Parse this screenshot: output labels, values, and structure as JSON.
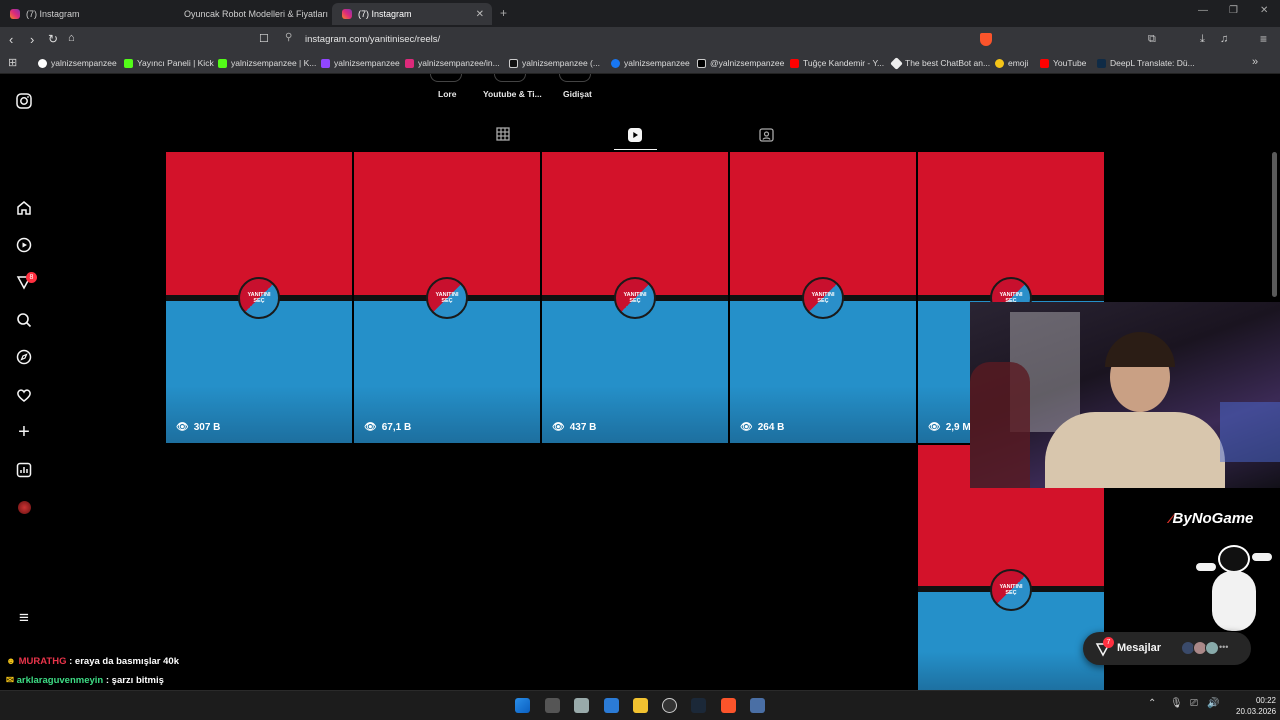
{
  "browser": {
    "tabs": [
      {
        "label": "(7) Instagram",
        "active": false
      },
      {
        "label": "Oyuncak Robot Modelleri & Fiyatları",
        "active": false
      },
      {
        "label": "(7) Instagram",
        "active": true
      }
    ],
    "url": "instagram.com/yanitinisec/reels/",
    "bookmarks": [
      "yalnizsempanzee",
      "Yayıncı Paneli | Kick",
      "yalnizsempanzee | K...",
      "yalnizsempanzee",
      "yalnizsempanzee/in...",
      "yalnizsempanzee (...",
      "yalnizsempanzee",
      "@yalnizsempanzee",
      "Tuğçe Kandemir - Y...",
      "The best ChatBot an...",
      "emoji",
      "YouTube",
      "DeepL Translate: Dü..."
    ]
  },
  "sidebar": {
    "notification_count": "8"
  },
  "highlights": [
    "Lore",
    "Youtube & Ti...",
    "Gidişat"
  ],
  "reels": [
    {
      "views": "307 B",
      "logo_line1": "YANITINI",
      "logo_line2": "SEÇ"
    },
    {
      "views": "67,1 B",
      "logo_line1": "YANITINI",
      "logo_line2": "SEÇ"
    },
    {
      "views": "437 B",
      "logo_line1": "YANITINI",
      "logo_line2": "SEÇ"
    },
    {
      "views": "264 B",
      "logo_line1": "YANITINI",
      "logo_line2": "SEÇ"
    },
    {
      "views": "2,9 M",
      "logo_line1": "YANITINI",
      "logo_line2": "SEÇ"
    },
    {
      "views": "",
      "logo_line1": "YANITINI",
      "logo_line2": "SEÇ"
    }
  ],
  "overlay": {
    "brand": "ByNoGame",
    "chat": [
      {
        "user": "MURATHG",
        "text": ": eraya da basmışlar 40k",
        "user_color": "#e8344a"
      },
      {
        "user": "arklaraguvenmeyin",
        "text": ": şarzı bitmiş",
        "user_color": "#3ddc84"
      }
    ]
  },
  "messages": {
    "label": "Mesajlar",
    "badge": "7"
  },
  "taskbar": {
    "time": "00:22",
    "date": "20.03.2026"
  },
  "colors": {
    "red": "#d3122a",
    "blue": "#2590c9",
    "accent_badge": "#ff3040"
  }
}
